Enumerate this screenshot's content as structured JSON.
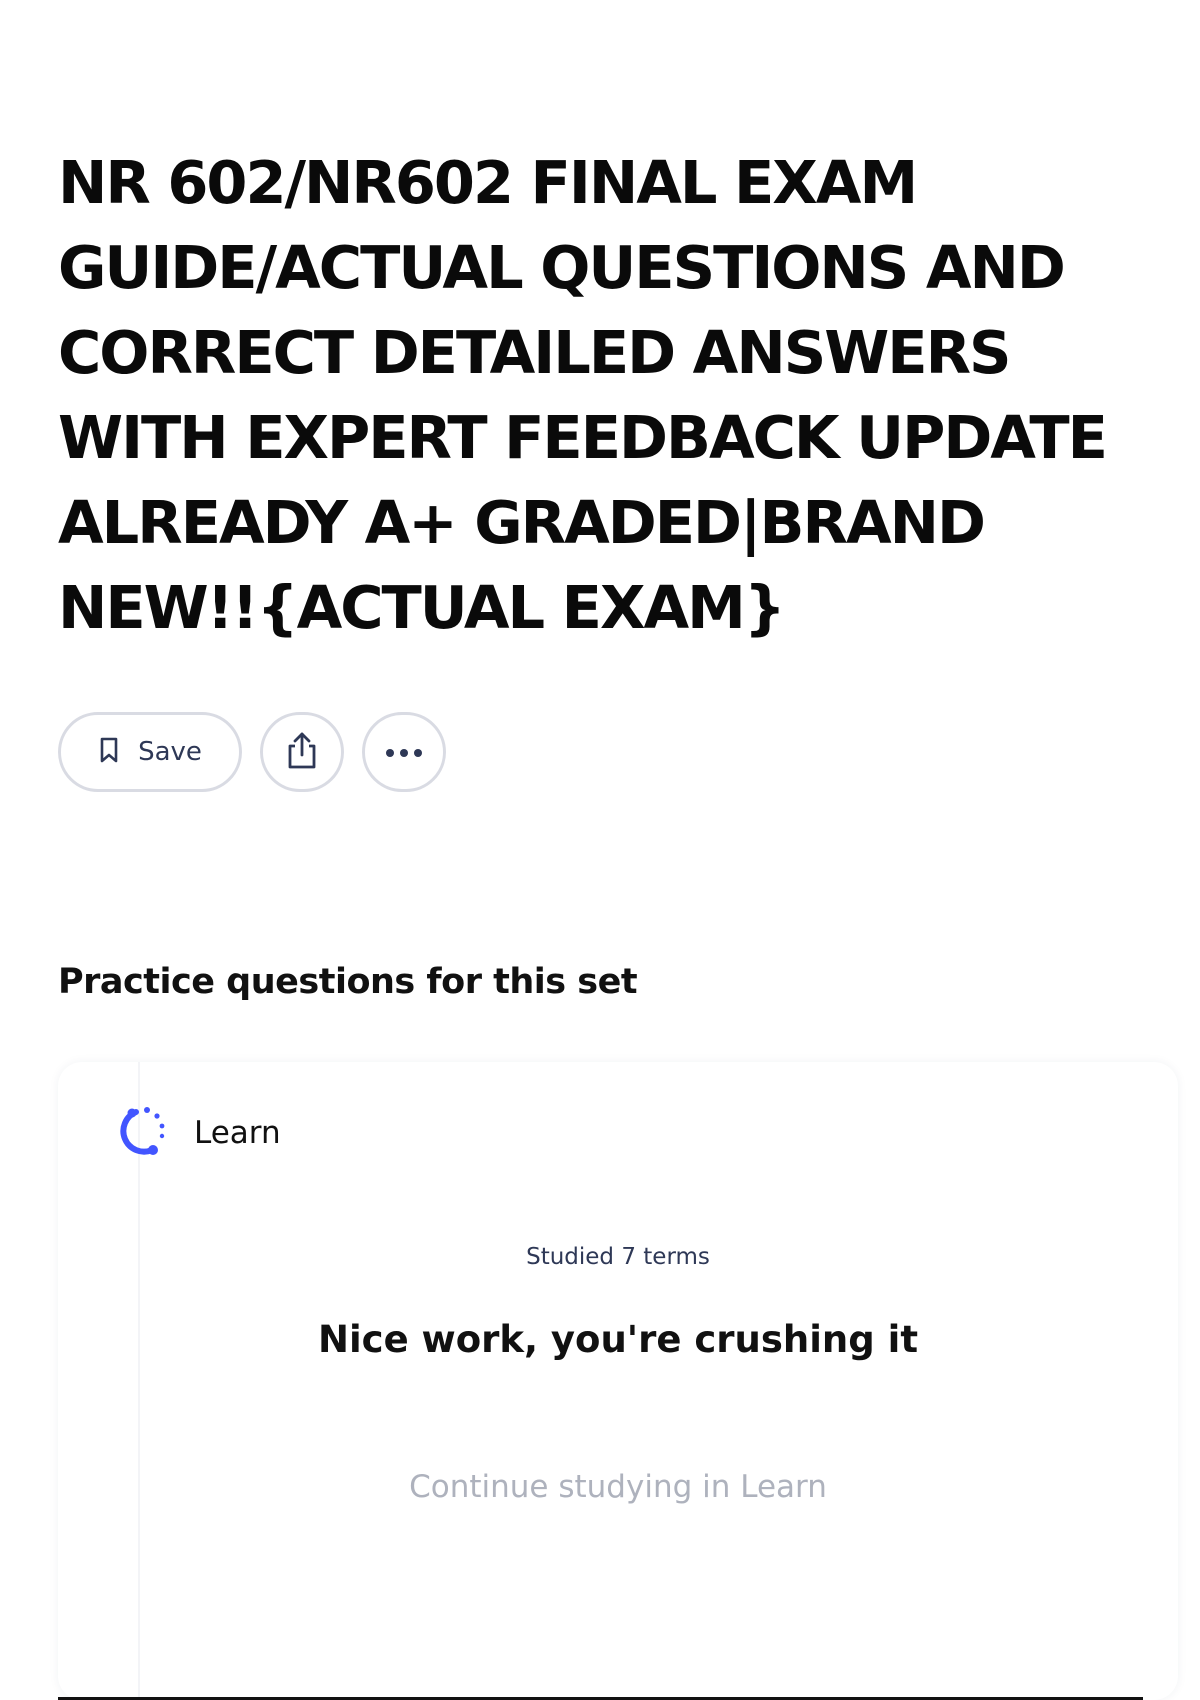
{
  "page": {
    "title": "NR 602/NR602 FINAL EXAM GUIDE/ACTUAL QUESTIONS AND CORRECT DETAILED ANSWERS WITH EXPERT FEEDBACK UPDATE ALREADY A+ GRADED|BRAND NEW!!{ACTUAL EXAM}"
  },
  "actions": {
    "save_label": "Save",
    "save_icon": "bookmark-icon",
    "share_icon": "share-icon",
    "more_icon": "more-horizontal-icon"
  },
  "practice": {
    "heading": "Practice questions for this set",
    "learn": {
      "label": "Learn",
      "icon": "learn-progress-icon",
      "studied": "Studied 7 terms",
      "message": "Nice work, you're crushing it",
      "continue_label": "Continue studying in Learn"
    }
  },
  "colors": {
    "accent": "#4255ff",
    "text": "#111111",
    "muted": "#aeb2bd",
    "border": "#d9dbe3"
  }
}
